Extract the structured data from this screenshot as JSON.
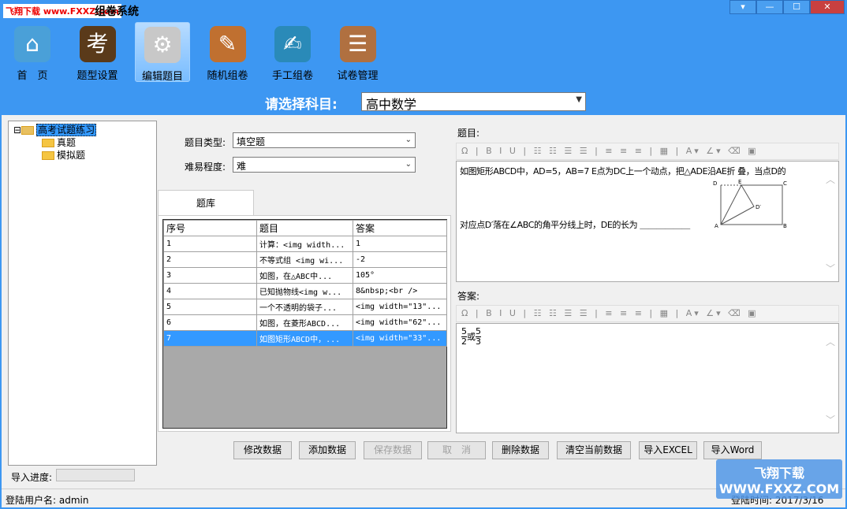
{
  "window": {
    "watermark": "飞翔下载 www.FXXZ.com",
    "title": "组卷系统",
    "controls": [
      "▾",
      "—",
      "☐",
      "✕"
    ]
  },
  "toolbar": [
    {
      "label": "首　页",
      "icon": "home-icon",
      "color": "#4aa0d8",
      "glyph": "⌂"
    },
    {
      "label": "题型设置",
      "icon": "book-icon",
      "color": "#5a3a1a",
      "glyph": "考"
    },
    {
      "label": "编辑题目",
      "icon": "gear-icon",
      "color": "#c8c8c8",
      "glyph": "⚙"
    },
    {
      "label": "随机组卷",
      "icon": "pencil-icon",
      "color": "#c07030",
      "glyph": "✎"
    },
    {
      "label": "手工组卷",
      "icon": "notebook-icon",
      "color": "#2a8ab8",
      "glyph": "✍"
    },
    {
      "label": "试卷管理",
      "icon": "clipboard-icon",
      "color": "#b07040",
      "glyph": "☰"
    }
  ],
  "subject": {
    "label": "请选择科目:",
    "value": "高中数学"
  },
  "tree": {
    "root": "高考试题练习",
    "children": [
      "真题",
      "模拟题"
    ]
  },
  "form": {
    "type_label": "题目类型:",
    "type_value": "填空题",
    "difficulty_label": "难易程度:",
    "difficulty_value": "难"
  },
  "tab": "题库",
  "table": {
    "headers": [
      "序号",
      "题目",
      "答案"
    ],
    "rows": [
      [
        "1",
        "计算：<img width...",
        "1"
      ],
      [
        "2",
        "不等式组 <img wi...",
        "-2"
      ],
      [
        "3",
        "如图，在△ABC中...",
        "105°"
      ],
      [
        "4",
        "已知抛物线<img w...",
        "8&nbsp;<br />"
      ],
      [
        "5",
        "一个不透明的袋子...",
        "<img width=\"13\"..."
      ],
      [
        "6",
        "如图，在菱形ABCD...",
        "<img width=\"62\"..."
      ],
      [
        "7",
        "如图矩形ABCD中，...",
        "<img width=\"33\"..."
      ]
    ],
    "selected": 7
  },
  "question": {
    "label": "题目:",
    "line1": "如图矩形ABCD中，AD=5，AB=7 E点为DC上一个动点，把△ADE沿AE折 叠，当点D的",
    "line2": "对应点D′落在∠ABC的角平分线上时，DE的长为 ＿＿＿＿＿＿",
    "figure_labels": [
      "D",
      "E",
      "C",
      "D′",
      "A",
      "B"
    ]
  },
  "answer": {
    "label": "答案:",
    "n1": "5",
    "d1": "2",
    "or": "或",
    "n2": "5",
    "d2": "3"
  },
  "editor_toolbar": "Ω | B I U | ☷ ☷ ☰ ☰ | ≡ ≡ ≡ | ▦ | A▾ ∠▾ ⌫ ▣",
  "buttons": [
    {
      "label": "修改数据",
      "enabled": true
    },
    {
      "label": "添加数据",
      "enabled": true
    },
    {
      "label": "保存数据",
      "enabled": false
    },
    {
      "label": "取　消",
      "enabled": false
    },
    {
      "label": "删除数据",
      "enabled": true
    },
    {
      "label": "清空当前数据",
      "enabled": true
    },
    {
      "label": "导入EXCEL",
      "enabled": true
    },
    {
      "label": "导入Word",
      "enabled": true
    }
  ],
  "import_progress_label": "导入进度:",
  "import_progress": 0,
  "status": {
    "user": "登陆用户名: admin",
    "time": "登陆时间: 2017/3/16"
  },
  "corner_watermark": "飞翔下载 WWW.FXXZ.COM"
}
